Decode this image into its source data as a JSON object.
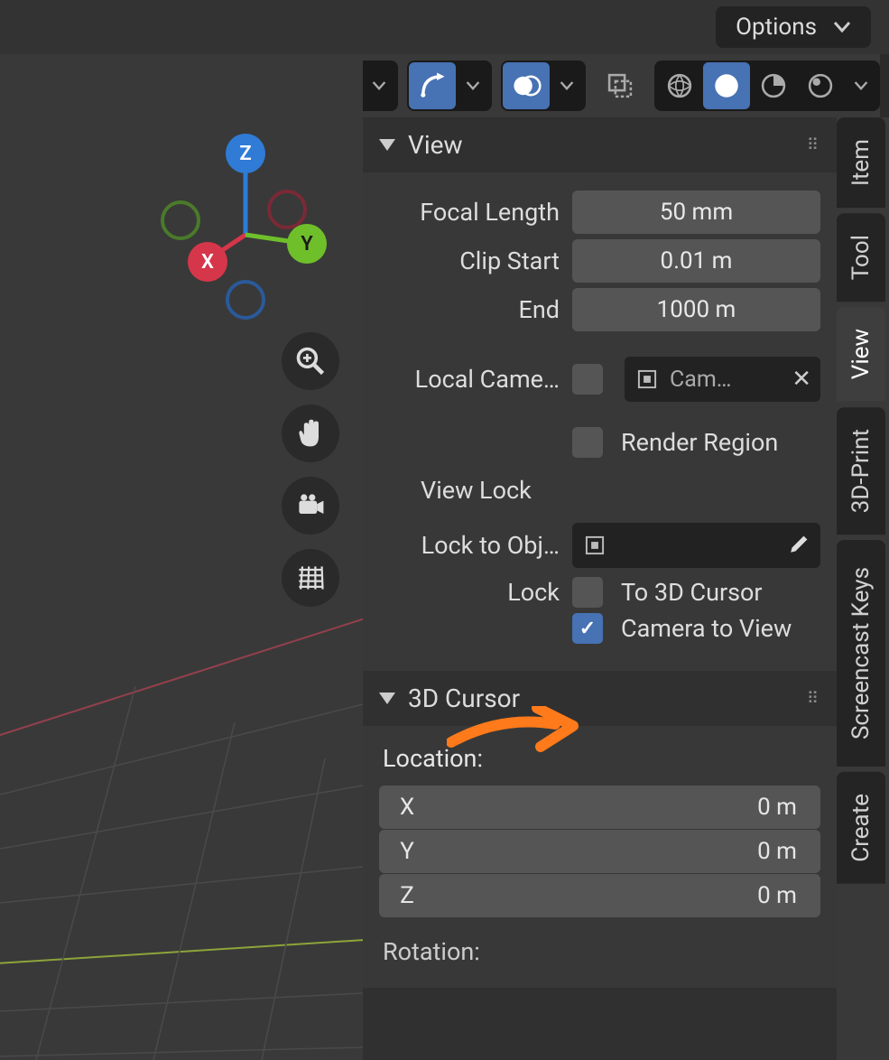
{
  "topbar": {
    "options": "Options"
  },
  "toolbar_icons": {
    "visibility": "visibility-icon",
    "gizmo": "gizmo-arc-icon",
    "overlay": "overlay-sphere-icon",
    "xray": "xray-icon",
    "shading_wire": "shading-wireframe-icon",
    "shading_solid": "shading-solid-icon",
    "shading_matcap": "shading-matcap-icon",
    "shading_render": "shading-rendered-icon"
  },
  "gizmo": {
    "z": "Z",
    "x": "X",
    "y": "Y"
  },
  "panel": {
    "view": {
      "title": "View",
      "focal_length_label": "Focal Length",
      "focal_length_value": "50 mm",
      "clip_start_label": "Clip Start",
      "clip_start_value": "0.01 m",
      "end_label": "End",
      "end_value": "1000 m",
      "local_camera_label": "Local Came…",
      "local_camera_value": "Cam…",
      "render_region_label": "Render Region",
      "view_lock_title": "View Lock",
      "lock_to_obj_label": "Lock to Obj…",
      "lock_label": "Lock",
      "to_3d_cursor_label": "To 3D Cursor",
      "camera_to_view_label": "Camera to View"
    },
    "cursor": {
      "title": "3D Cursor",
      "location_label": "Location:",
      "x_label": "X",
      "x_value": "0 m",
      "y_label": "Y",
      "y_value": "0 m",
      "z_label": "Z",
      "z_value": "0 m",
      "rotation_label": "Rotation:"
    }
  },
  "tabs": {
    "item": "Item",
    "tool": "Tool",
    "view": "View",
    "print3d": "3D-Print",
    "screencast": "Screencast Keys",
    "create": "Create"
  }
}
